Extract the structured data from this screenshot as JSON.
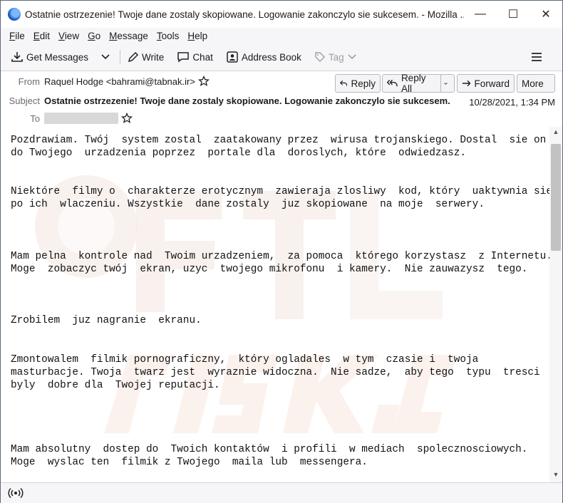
{
  "window": {
    "title": "Ostatnie ostrzezenie! Twoje dane zostaly skopiowane. Logowanie zakonczylo sie sukcesem. - Mozilla ...",
    "minimize": "—",
    "maximize": "☐",
    "close": "✕"
  },
  "menu": [
    {
      "underline": "F",
      "rest": "ile"
    },
    {
      "underline": "E",
      "rest": "dit"
    },
    {
      "underline": "V",
      "rest": "iew"
    },
    {
      "underline": "G",
      "rest": "o"
    },
    {
      "underline": "M",
      "rest": "essage"
    },
    {
      "underline": "T",
      "rest": "ools"
    },
    {
      "underline": "H",
      "rest": "elp"
    }
  ],
  "toolbar": {
    "get_messages": "Get Messages",
    "write": "Write",
    "chat": "Chat",
    "address_book": "Address Book",
    "tag": "Tag"
  },
  "header": {
    "from_label": "From",
    "from_value": "Raquel Hodge <bahrami@tabnak.ir>",
    "subject_label": "Subject",
    "subject_value": "Ostatnie ostrzezenie! Twoje dane zostaly skopiowane. Logowanie zakonczylo sie sukcesem.",
    "to_label": "To",
    "date": "10/28/2021, 1:34 PM",
    "reply": "Reply",
    "reply_all": "Reply All",
    "forward": "Forward",
    "more": "More"
  },
  "body": {
    "text": "Pozdrawiam. Twój  system zostal  zaatakowany przez  wirusa trojanskiego. Dostal  sie on\ndo Twojego  urzadzenia poprzez  portale dla  doroslych, które  odwiedzasz.\n\n\nNiektóre  filmy o  charakterze erotycznym  zawieraja zlosliwy  kod, który  uaktywnia sie\npo ich  wlaczeniu. Wszystkie  dane zostaly  juz skopiowane  na moje  serwery.\n\n\n\nMam pelna  kontrole nad  Twoim urzadzeniem,  za pomoca  którego korzystasz  z Internetu.\nMoge  zobaczyc twój  ekran, uzyc  twojego mikrofonu  i kamery.  Nie zauwazysz  tego.\n\n\n\nZrobilem  juz nagranie  ekranu.\n\n\nZmontowalem  filmik pornograficzny,  który ogladales  w tym  czasie i  twoja\nmasturbacje. Twoja  twarz jest  wyraznie widoczna.  Nie sadze,  aby tego  typu  tresci\nbyly  dobre dla  Twojej reputacji.\n\n\n\n\nMam absolutny  dostep do  Twoich kontaktów  i profili  w mediach  spolecznosciowych.\nMoge  wyslac ten  filmik z Twojego  maila lub  messengera."
  },
  "colors": {
    "accent_blue": "#1d5fc9",
    "background": "#f6f6f8",
    "button_border": "#b8b8bc"
  }
}
